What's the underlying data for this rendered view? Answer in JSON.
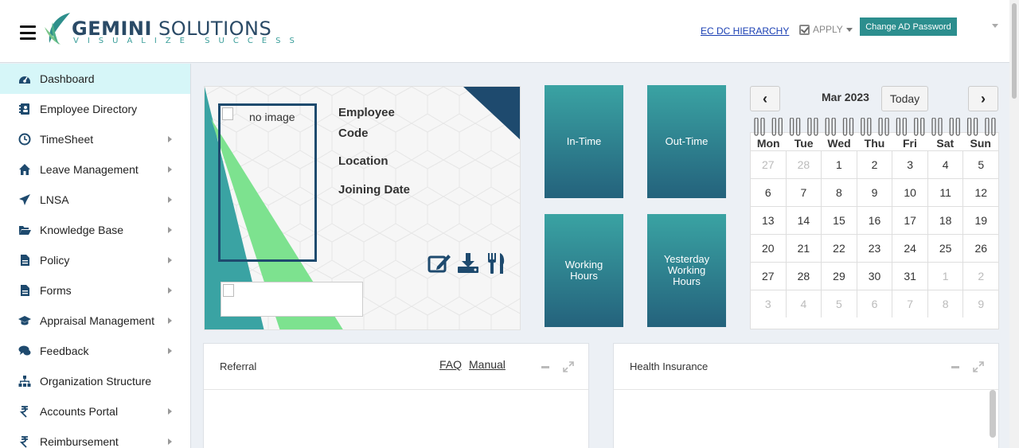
{
  "header": {
    "logo_main_bold": "GEMINI",
    "logo_main_rest": " SOLUTIONS",
    "logo_tagline": "VISUALIZE SUCCESS",
    "ecdc_link": "EC DC HIERARCHY",
    "apply_label": "APPLY",
    "change_ad_password": "Change AD Password"
  },
  "sidebar": {
    "items": [
      {
        "label": "Dashboard",
        "icon": "dashboard-icon",
        "has_submenu": false,
        "active": true
      },
      {
        "label": "Employee Directory",
        "icon": "address-book-icon",
        "has_submenu": false
      },
      {
        "label": "TimeSheet",
        "icon": "clock-icon",
        "has_submenu": true
      },
      {
        "label": "Leave Management",
        "icon": "home-icon",
        "has_submenu": true
      },
      {
        "label": "LNSA",
        "icon": "paper-plane-icon",
        "has_submenu": true
      },
      {
        "label": "Knowledge Base",
        "icon": "folder-open-icon",
        "has_submenu": true
      },
      {
        "label": "Policy",
        "icon": "document-icon",
        "has_submenu": true
      },
      {
        "label": "Forms",
        "icon": "document-icon",
        "has_submenu": true
      },
      {
        "label": "Appraisal Management",
        "icon": "graduation-cap-icon",
        "has_submenu": true
      },
      {
        "label": "Feedback",
        "icon": "comments-icon",
        "has_submenu": true
      },
      {
        "label": "Organization Structure",
        "icon": "sitemap-icon",
        "has_submenu": false
      },
      {
        "label": "Accounts Portal",
        "icon": "rupee-icon",
        "has_submenu": true
      },
      {
        "label": "Reimbursement",
        "icon": "rupee-icon",
        "has_submenu": true
      }
    ]
  },
  "profile": {
    "photo_alt": "no image",
    "label_code_line1": "Employee",
    "label_code_line2": "Code",
    "label_location": "Location",
    "label_joining": "Joining Date"
  },
  "tiles": {
    "in_time": "In-Time",
    "out_time": "Out-Time",
    "working_hours_l1": "Working",
    "working_hours_l2": "Hours",
    "yesterday_l1": "Yesterday",
    "yesterday_l2": "Working",
    "yesterday_l3": "Hours",
    "color_top": "#3aa3a3",
    "color_bottom": "#24627c"
  },
  "calendar": {
    "prev_label": "‹",
    "next_label": "›",
    "title": "Mar 2023",
    "today_label": "Today",
    "weekdays": [
      "Mon",
      "Tue",
      "Wed",
      "Thu",
      "Fri",
      "Sat",
      "Sun"
    ],
    "weeks": [
      [
        {
          "d": "27",
          "m": true
        },
        {
          "d": "28",
          "m": true
        },
        {
          "d": "1"
        },
        {
          "d": "2"
        },
        {
          "d": "3"
        },
        {
          "d": "4"
        },
        {
          "d": "5"
        }
      ],
      [
        {
          "d": "6"
        },
        {
          "d": "7"
        },
        {
          "d": "8"
        },
        {
          "d": "9"
        },
        {
          "d": "10"
        },
        {
          "d": "11"
        },
        {
          "d": "12"
        }
      ],
      [
        {
          "d": "13"
        },
        {
          "d": "14"
        },
        {
          "d": "15"
        },
        {
          "d": "16"
        },
        {
          "d": "17"
        },
        {
          "d": "18"
        },
        {
          "d": "19"
        }
      ],
      [
        {
          "d": "20"
        },
        {
          "d": "21"
        },
        {
          "d": "22"
        },
        {
          "d": "23"
        },
        {
          "d": "24"
        },
        {
          "d": "25"
        },
        {
          "d": "26"
        }
      ],
      [
        {
          "d": "27"
        },
        {
          "d": "28"
        },
        {
          "d": "29"
        },
        {
          "d": "30"
        },
        {
          "d": "31"
        },
        {
          "d": "1",
          "m": true
        },
        {
          "d": "2",
          "m": true
        }
      ],
      [
        {
          "d": "3",
          "m": true
        },
        {
          "d": "4",
          "m": true
        },
        {
          "d": "5",
          "m": true
        },
        {
          "d": "6",
          "m": true
        },
        {
          "d": "7",
          "m": true
        },
        {
          "d": "8",
          "m": true
        },
        {
          "d": "9",
          "m": true
        }
      ]
    ]
  },
  "panels": {
    "referral_title": "Referral",
    "faq_link": "FAQ",
    "manual_link": "Manual",
    "health_title": "Health Insurance"
  },
  "colors": {
    "accent": "#2c8e8e",
    "brand_navy": "#1e4a6e",
    "active_nav": "#d6f6f8",
    "link": "#1a3fb3"
  }
}
